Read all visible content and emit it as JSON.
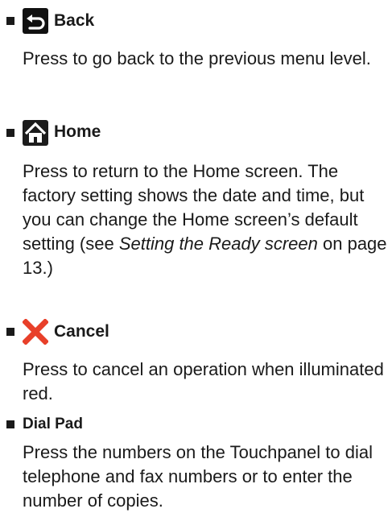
{
  "items": [
    {
      "icon": "back-arrow-icon",
      "label": "Back",
      "description": "Press to go back to the previous menu level."
    },
    {
      "icon": "home-icon",
      "label": "Home",
      "description_pre": "Press to return to the Home screen. The factory setting shows the date and time, but you can change the Home screen’s default setting (see ",
      "description_link": "Setting the Ready screen",
      "description_post": " on page 13.)"
    },
    {
      "icon": "cancel-x-icon",
      "label": "Cancel",
      "description": "Press to cancel an operation when illuminated red."
    },
    {
      "label": "Dial Pad",
      "description": "Press the numbers on the Touchpanel to dial telephone and fax numbers or to enter the number of copies."
    }
  ],
  "colors": {
    "back_icon_bg": "#111111",
    "home_icon_bg": "#1c1c1c",
    "cancel_red": "#e8402a",
    "text": "#1a1a1a"
  }
}
